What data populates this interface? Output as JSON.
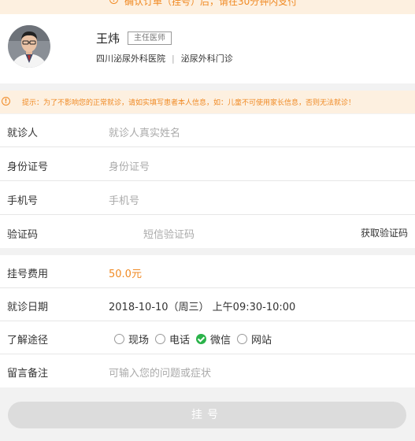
{
  "banner": {
    "text": "确认订单（挂号）后，请在30分钟内支付"
  },
  "doctor": {
    "name": "王炜",
    "title": "主任医师",
    "hospital": "四川泌尿外科医院",
    "separator": "|",
    "department": "泌尿外科门诊"
  },
  "tip": {
    "text": "提示：为了不影响您的正常就诊，请如实填写患者本人信息，如：儿童不可使用家长信息，否则无法就诊！"
  },
  "form": {
    "patient": {
      "label": "就诊人",
      "placeholder": "就诊人真实姓名"
    },
    "id_card": {
      "label": "身份证号",
      "placeholder": "身份证号"
    },
    "phone": {
      "label": "手机号",
      "placeholder": "手机号"
    },
    "code": {
      "label": "验证码",
      "placeholder": "短信验证码",
      "button": "获取验证码"
    }
  },
  "order": {
    "fee": {
      "label": "挂号费用",
      "value": "50.0元"
    },
    "date": {
      "label": "就诊日期",
      "value": "2018-10-10（周三） 上午09:30-10:00"
    },
    "source": {
      "label": "了解途径",
      "options": [
        "现场",
        "电话",
        "微信",
        "网站"
      ],
      "selected": "微信"
    },
    "remark": {
      "label": "留言备注",
      "placeholder": "可输入您的问题或症状"
    }
  },
  "submit": {
    "label": "挂号"
  },
  "colors": {
    "accent": "#f08a24",
    "selected": "#2bb34a",
    "button": "#dcdcdc"
  }
}
